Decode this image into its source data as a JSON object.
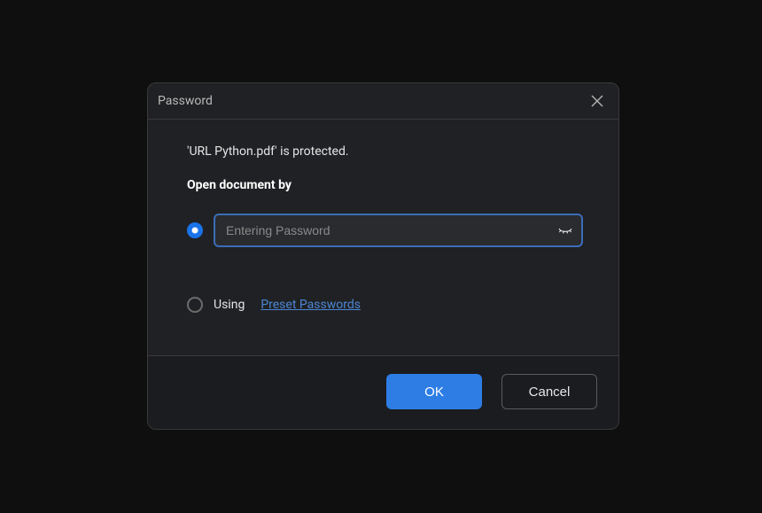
{
  "dialog": {
    "title": "Password",
    "message": "'URL Python.pdf' is protected.",
    "heading": "Open document by",
    "option_password": {
      "placeholder": "Entering Password",
      "value": "",
      "selected": true
    },
    "option_preset": {
      "label": "Using",
      "link_label": "Preset Passwords",
      "selected": false
    },
    "buttons": {
      "ok": "OK",
      "cancel": "Cancel"
    }
  }
}
